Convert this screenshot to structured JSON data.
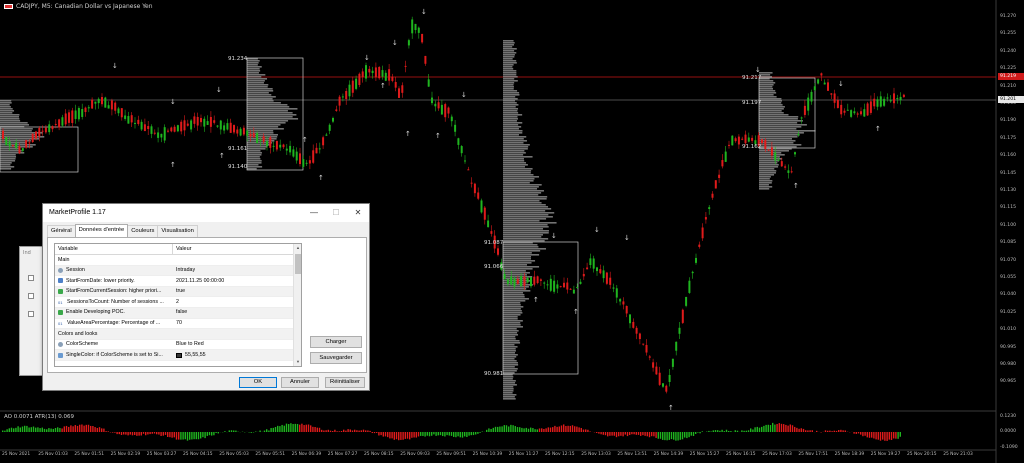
{
  "chart": {
    "title": "CADJPY, M5:  Canadian Dollar vs Japanese Yen",
    "indicator_title": "AO 0.0071 ATR(13) 0.069",
    "price_axis": [
      "91.270",
      "91.255",
      "91.240",
      "91.225",
      "91.210",
      "91.205",
      "91.190",
      "91.175",
      "91.160",
      "91.145",
      "91.130",
      "91.115",
      "91.100",
      "91.085",
      "91.070",
      "91.055",
      "91.040",
      "91.025",
      "91.010",
      "90.995",
      "90.980",
      "90.965"
    ],
    "price_tag_red": "91.219",
    "price_tag_white": "91.201",
    "indicator_axis": [
      "0.1230",
      "0.0000",
      "-0.1090"
    ],
    "time_axis": [
      "25 Nov 2021",
      "25 Nov 01:03",
      "25 Nov 01:51",
      "25 Nov 02:19",
      "25 Nov 03:27",
      "25 Nov 04:15",
      "25 Nov 05:03",
      "25 Nov 05:51",
      "25 Nov 06:39",
      "25 Nov 07:27",
      "25 Nov 08:15",
      "25 Nov 09:03",
      "25 Nov 09:51",
      "25 Nov 10:39",
      "25 Nov 11:27",
      "25 Nov 12:15",
      "25 Nov 13:03",
      "25 Nov 13:51",
      "25 Nov 14:39",
      "25 Nov 15:27",
      "25 Nov 16:15",
      "25 Nov 17:03",
      "25 Nov 17:51",
      "25 Nov 18:39",
      "25 Nov 19:27",
      "25 Nov 20:15",
      "25 Nov 21:03"
    ],
    "levels": [
      {
        "text": "91.234"
      },
      {
        "text": "91.161"
      },
      {
        "text": "91.140"
      },
      {
        "text": "91.087"
      },
      {
        "text": "91.066"
      },
      {
        "text": "90.981"
      },
      {
        "text": "91.217"
      },
      {
        "text": "91.197"
      },
      {
        "text": "91.162"
      }
    ],
    "colors": {
      "bull": "#1fb51f",
      "bear": "#e01b1b",
      "red_line": "#c81414",
      "profile": "#9a9a9a"
    }
  },
  "ghost_window": {
    "title": "Ind"
  },
  "dialog": {
    "title": "MarketProfile 1.17",
    "controls": {
      "minimize": "—",
      "maximize": "☐",
      "close": "✕"
    },
    "tabs": [
      {
        "label": "Général"
      },
      {
        "label": "Données d'entrée"
      },
      {
        "label": "Couleurs"
      },
      {
        "label": "Visualisation"
      }
    ],
    "grid": {
      "col_variable": "Variable",
      "col_value": "Valeur",
      "rows": [
        {
          "variable": "Main",
          "value": "",
          "section": true
        },
        {
          "variable": "Session",
          "value": "Intraday",
          "icon": "gear"
        },
        {
          "variable": "StartFromDate: lower priority.",
          "value": "2021.11.25 00:00:00",
          "icon": "cal"
        },
        {
          "variable": "StartFromCurrentSession: higher priori...",
          "value": "true",
          "icon": "bool"
        },
        {
          "variable": "SessionsToCount: Number of sessions ...",
          "value": "2",
          "icon": "num"
        },
        {
          "variable": "Enable Developing POC.",
          "value": "false",
          "icon": "bool"
        },
        {
          "variable": "ValueAreaPercentage: Percentage of ...",
          "value": "70",
          "icon": "num"
        },
        {
          "variable": "Colors and looks",
          "value": "",
          "section": true
        },
        {
          "variable": "ColorScheme",
          "value": "Blue to Red",
          "icon": "gear"
        },
        {
          "variable": "SingleColor: if ColorScheme is set to Si...",
          "value": "55,55,55",
          "icon": "arrows",
          "swatch": true
        }
      ]
    },
    "buttons": {
      "load": "Charger",
      "save": "Sauvegarder",
      "ok": "OK",
      "cancel": "Annuler",
      "reset": "Réinitialiser"
    }
  }
}
